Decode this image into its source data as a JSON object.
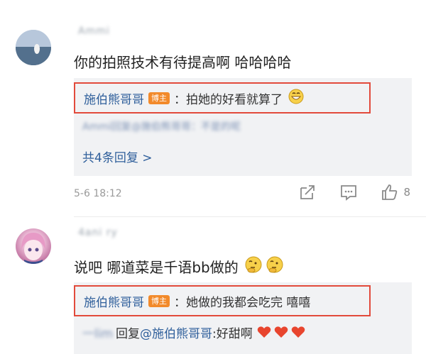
{
  "comments": [
    {
      "username": "Ammi",
      "text": "你的拍照技术有待提高啊 哈哈哈哈",
      "replies": [
        {
          "author": "施伯熊哥哥",
          "badge": "博主",
          "text": "：拍她的好看就算了",
          "emoji": "grinning-emoji"
        },
        {
          "author": "Ammi回复",
          "text": "@施伯熊哥哥：不是的呢"
        }
      ],
      "more_label": "共4条回复 >",
      "timestamp": "5-6 18:12",
      "likes": "8"
    },
    {
      "username": "4ani ry",
      "text": "说吧 哪道菜是千语bb做的",
      "emojis": [
        "thinking-emoji",
        "thinking-emoji"
      ],
      "replies": [
        {
          "author": "施伯熊哥哥",
          "badge": "博主",
          "text": "：她做的我都会吃完 嘻嘻"
        },
        {
          "author": "一lim",
          "connector": "回复",
          "mention": "@施伯熊哥哥",
          "text": ":好甜啊",
          "hearts": 3
        }
      ]
    }
  ],
  "icons": {
    "share": "share-icon",
    "comment": "comment-icon",
    "like": "thumbs-up-icon"
  },
  "colors": {
    "author": "#2f5f9b",
    "badge": "#f28a2b",
    "highlight": "#e24a3b",
    "heart": "#e8452e"
  }
}
